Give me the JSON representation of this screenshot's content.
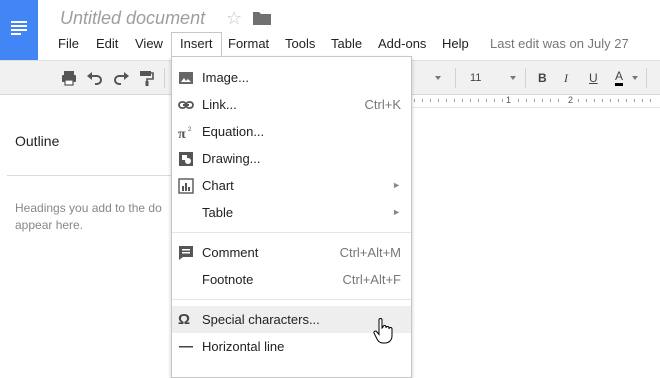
{
  "document": {
    "title": "Untitled document",
    "last_edit": "Last edit was on July 27"
  },
  "menubar": {
    "items": [
      "File",
      "Edit",
      "View",
      "Insert",
      "Format",
      "Tools",
      "Table",
      "Add-ons",
      "Help"
    ],
    "active": "Insert"
  },
  "toolbar": {
    "font_size": "11",
    "bold": "B",
    "italic": "I",
    "underline": "U",
    "text_color": "A"
  },
  "ruler": {
    "labels": [
      "1",
      "2"
    ]
  },
  "outline": {
    "title": "Outline",
    "hint_line1": "Headings you add to the do",
    "hint_line2": "appear here."
  },
  "insert_menu": {
    "items": [
      {
        "label": "Image...",
        "icon": "image-icon"
      },
      {
        "label": "Link...",
        "shortcut": "Ctrl+K",
        "icon": "link-icon"
      },
      {
        "label": "Equation...",
        "icon": "pi-icon"
      },
      {
        "label": "Drawing...",
        "icon": "drawing-icon"
      },
      {
        "label": "Chart",
        "submenu": true,
        "icon": "chart-icon"
      },
      {
        "label": "Table",
        "submenu": true
      },
      {
        "label": "Comment",
        "shortcut": "Ctrl+Alt+M",
        "icon": "comment-icon"
      },
      {
        "label": "Footnote",
        "shortcut": "Ctrl+Alt+F"
      },
      {
        "label": "Special characters...",
        "icon": "omega-icon",
        "hovered": true
      },
      {
        "label": "Horizontal line",
        "icon": "horizontal-line-icon"
      }
    ]
  },
  "colors": {
    "brand_blue": "#4285f4",
    "toolbar_bg": "#f1f1f1",
    "hover_bg": "#eeeeee",
    "muted_text": "#777777"
  }
}
